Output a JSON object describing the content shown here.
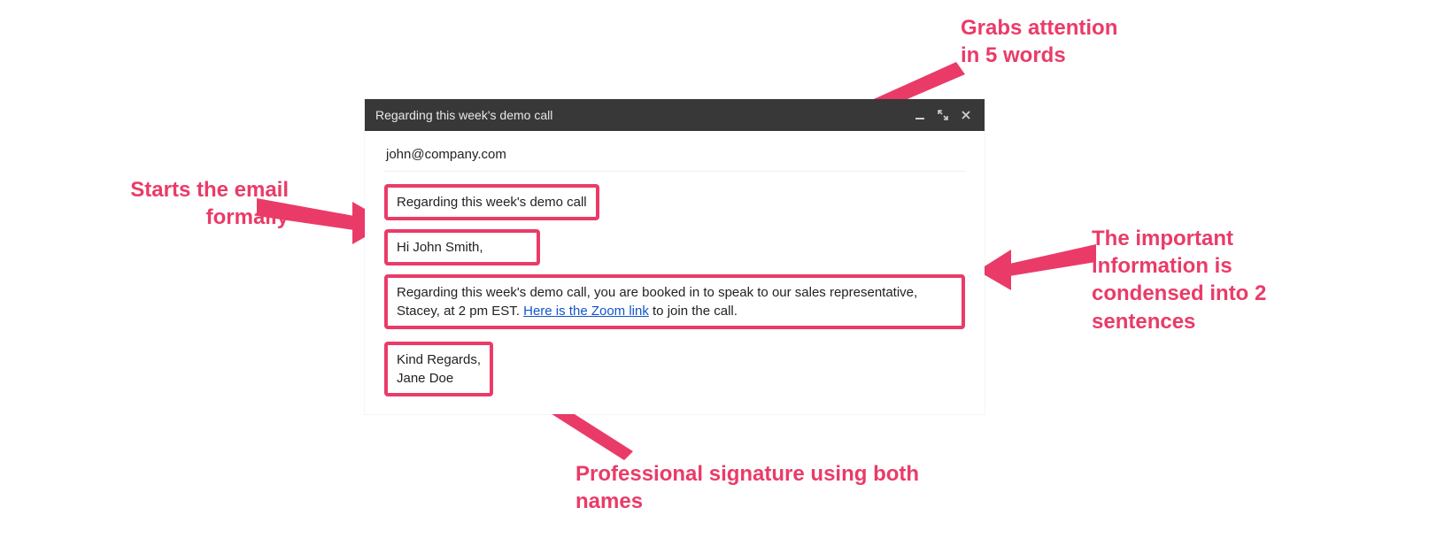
{
  "callouts": {
    "attention": "Grabs attention\nin 5 words",
    "formal": "Starts the email\nformally",
    "condensed": "The important\ninformation is\ncondensed into 2\nsentences",
    "signature": "Professional signature using both\nnames"
  },
  "compose": {
    "window_title": "Regarding this week's demo call",
    "recipient": "john@company.com",
    "subject": "Regarding this week's demo call",
    "greeting": "Hi John Smith,",
    "body_pre": "Regarding this week's demo call, you are booked in to speak to our sales representative, Stacey, at 2 pm EST. ",
    "body_link": "Here is the Zoom link",
    "body_post": " to join the call.",
    "signoff_line1": "Kind Regards,",
    "signoff_line2": "Jane Doe"
  },
  "accent_color": "#ea3b68"
}
